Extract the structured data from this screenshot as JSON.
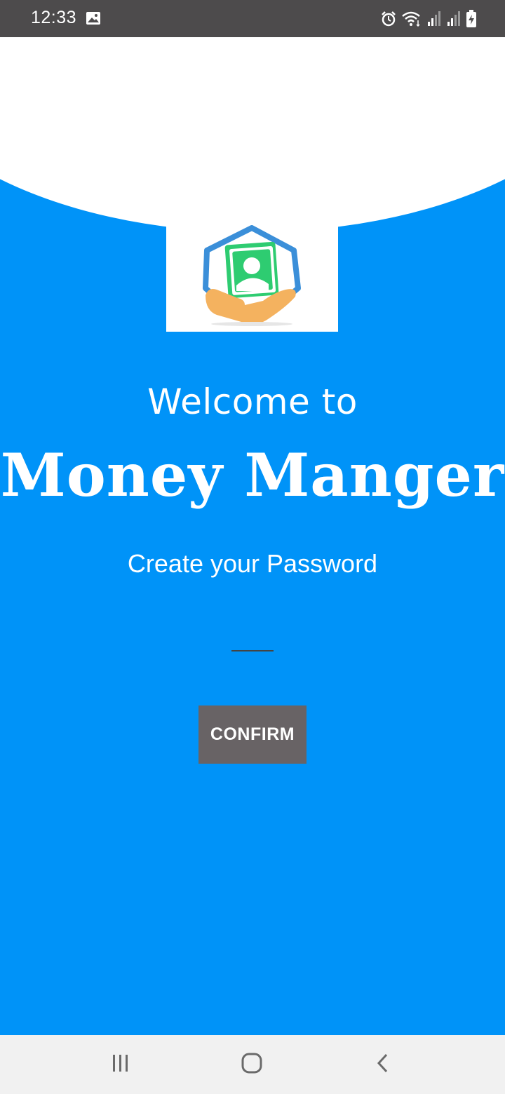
{
  "status_bar": {
    "time": "12:33",
    "icons": [
      "gallery-icon",
      "alarm-icon",
      "wifi-icon",
      "signal-icon",
      "signal-icon",
      "battery-charging-icon"
    ]
  },
  "welcome": {
    "line1": "Welcome to",
    "app_name": "Money Manger",
    "subtitle": "Create your Password"
  },
  "password_field": {
    "value": "",
    "placeholder": ""
  },
  "confirm_button": {
    "label": "CONFIRM"
  },
  "nav_bar": {
    "items": [
      "recent-apps-icon",
      "home-icon",
      "back-icon"
    ]
  },
  "colors": {
    "background": "#0093f8",
    "status_bar": "#4d4b4c",
    "button": "#686365",
    "nav_bar": "#f1f1f1",
    "logo_blue": "#3b8fd9",
    "logo_green": "#2ecc71",
    "logo_orange": "#f4b25f"
  }
}
